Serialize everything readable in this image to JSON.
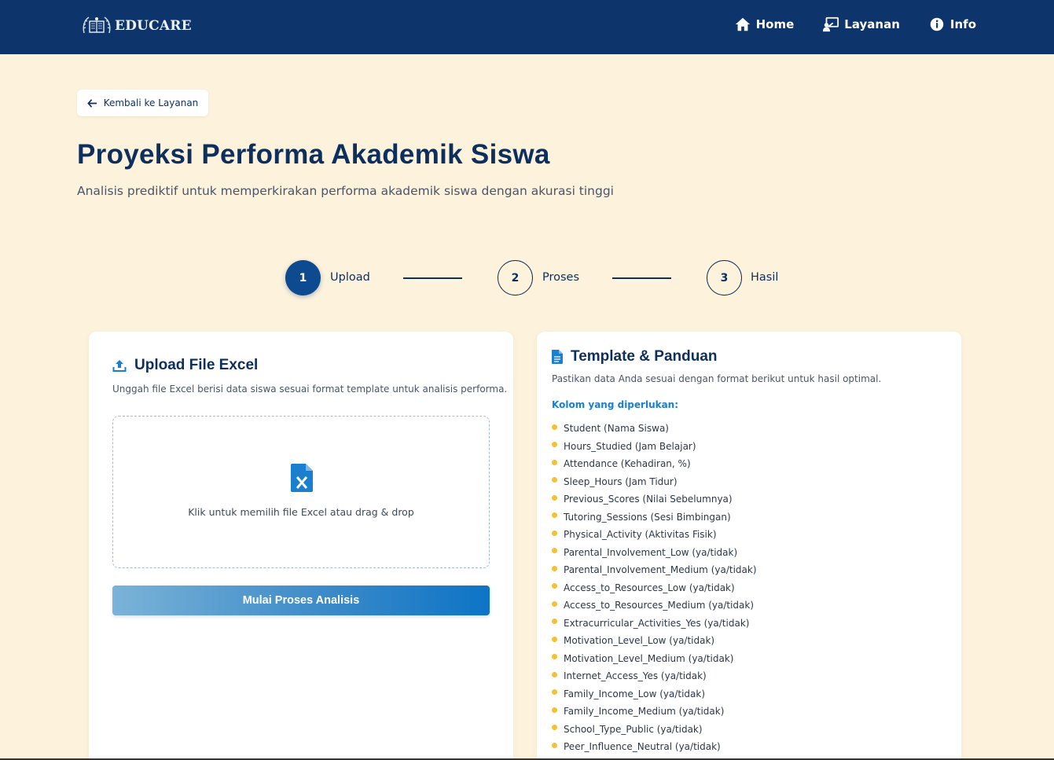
{
  "brand": {
    "name": "EDUCARE"
  },
  "nav": {
    "items": [
      {
        "label": "Home",
        "icon": "home-icon"
      },
      {
        "label": "Layanan",
        "icon": "services-icon"
      },
      {
        "label": "Info",
        "icon": "info-icon"
      }
    ]
  },
  "back_button": {
    "label": "Kembali ke Layanan"
  },
  "header": {
    "title": "Proyeksi Performa Akademik Siswa",
    "subtitle": "Analisis prediktif untuk memperkirakan performa akademik siswa dengan akurasi tinggi"
  },
  "stepper": {
    "steps": [
      {
        "number": "1",
        "label": "Upload",
        "active": true
      },
      {
        "number": "2",
        "label": "Proses",
        "active": false
      },
      {
        "number": "3",
        "label": "Hasil",
        "active": false
      }
    ]
  },
  "upload": {
    "title": "Upload File Excel",
    "description": "Unggah file Excel berisi data siswa sesuai format template untuk analisis performa.",
    "dropzone_text": "Klik untuk memilih file Excel atau drag & drop",
    "submit_label": "Mulai Proses Analisis"
  },
  "template": {
    "title": "Template & Panduan",
    "description": "Pastikan data Anda sesuai dengan format berikut untuk hasil optimal.",
    "columns_heading": "Kolom yang diperlukan:",
    "columns": [
      "Student (Nama Siswa)",
      "Hours_Studied (Jam Belajar)",
      "Attendance (Kehadiran, %)",
      "Sleep_Hours (Jam Tidur)",
      "Previous_Scores (Nilai Sebelumnya)",
      "Tutoring_Sessions (Sesi Bimbingan)",
      "Physical_Activity (Aktivitas Fisik)",
      "Parental_Involvement_Low (ya/tidak)",
      "Parental_Involvement_Medium (ya/tidak)",
      "Access_to_Resources_Low (ya/tidak)",
      "Access_to_Resources_Medium (ya/tidak)",
      "Extracurricular_Activities_Yes (ya/tidak)",
      "Motivation_Level_Low (ya/tidak)",
      "Motivation_Level_Medium (ya/tidak)",
      "Internet_Access_Yes (ya/tidak)",
      "Family_Income_Low (ya/tidak)",
      "Family_Income_Medium (ya/tidak)",
      "School_Type_Public (ya/tidak)",
      "Peer_Influence_Neutral (ya/tidak)"
    ]
  },
  "colors": {
    "navbar": "#0d346b",
    "page_bg": "#fdf2dc",
    "primary": "#0d2f5e",
    "accent_blue": "#1a7fcf",
    "bullet": "#f5c038"
  }
}
